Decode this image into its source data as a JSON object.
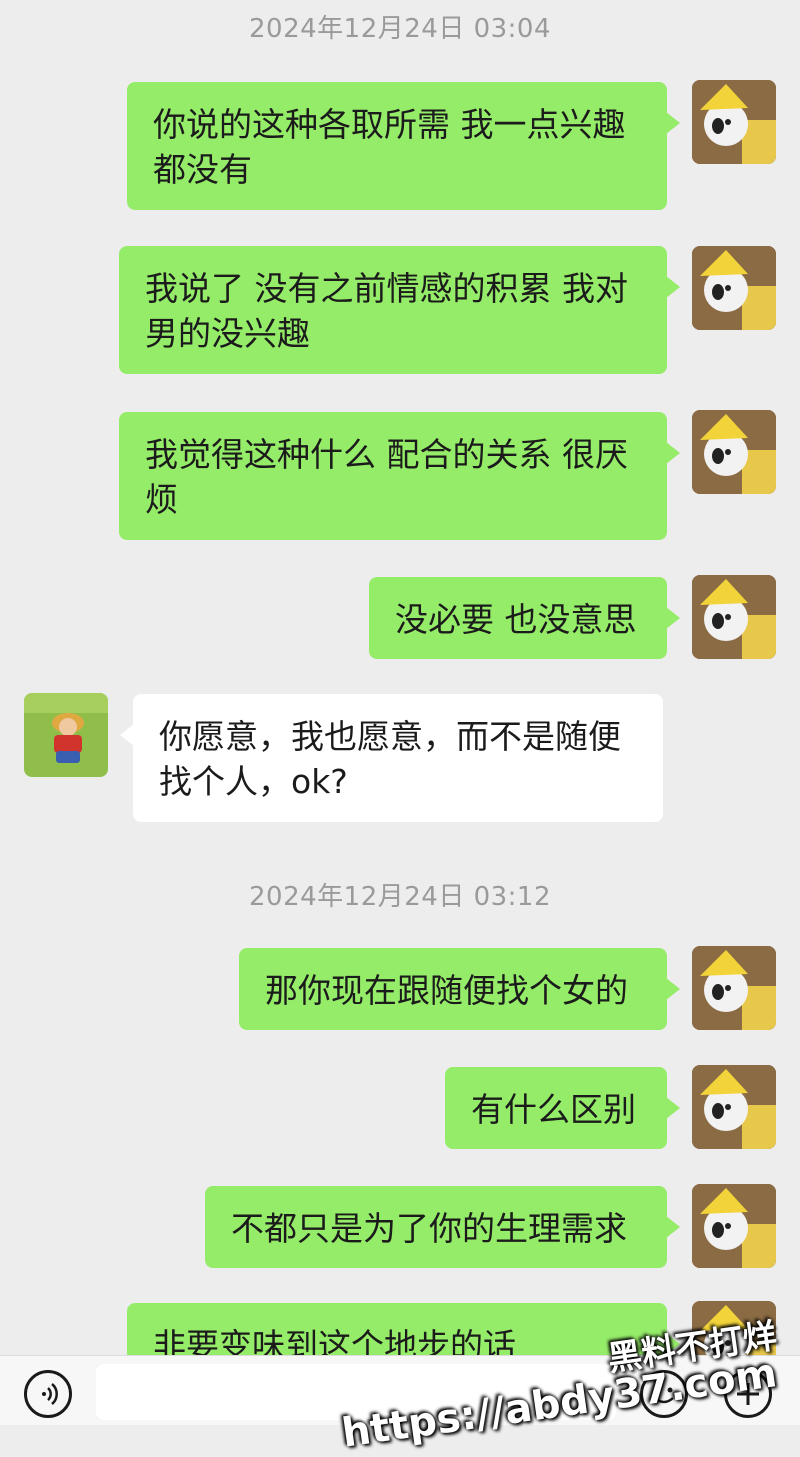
{
  "timestamps": [
    "2024年12月24日 03:04",
    "2024年12月24日 03:12"
  ],
  "messages": [
    {
      "side": "sent",
      "text": "你说的这种各取所需 我一点兴趣都没有"
    },
    {
      "side": "sent",
      "text": "我说了 没有之前情感的积累 我对男的没兴趣"
    },
    {
      "side": "sent",
      "text": "我觉得这种什么 配合的关系 很厌烦"
    },
    {
      "side": "sent",
      "text": "没必要 也没意思"
    },
    {
      "side": "received",
      "text": "你愿意，我也愿意，而不是随便找个人，ok?"
    },
    {
      "side": "sent",
      "text": "那你现在跟随便找个女的"
    },
    {
      "side": "sent",
      "text": "有什么区别"
    },
    {
      "side": "sent",
      "text": "不都只是为了你的生理需求"
    },
    {
      "side": "sent",
      "text": "非要变味到这个地步的话"
    }
  ],
  "avatars": {
    "self": "cat-in-yellow-hat-avatar",
    "contact": "cartoon-character-lying-on-grass-avatar"
  },
  "input_bar": {
    "voice_icon": "voice-icon",
    "emoji_icon": "emoji-icon",
    "plus_icon": "plus-icon"
  },
  "watermark": {
    "line1": "黑料不打烊",
    "line2": "https://abdy37.com"
  },
  "colors": {
    "background": "#ededed",
    "sent_bubble": "#95ec69",
    "received_bubble": "#ffffff",
    "timestamp_text": "#9a9a9a"
  }
}
